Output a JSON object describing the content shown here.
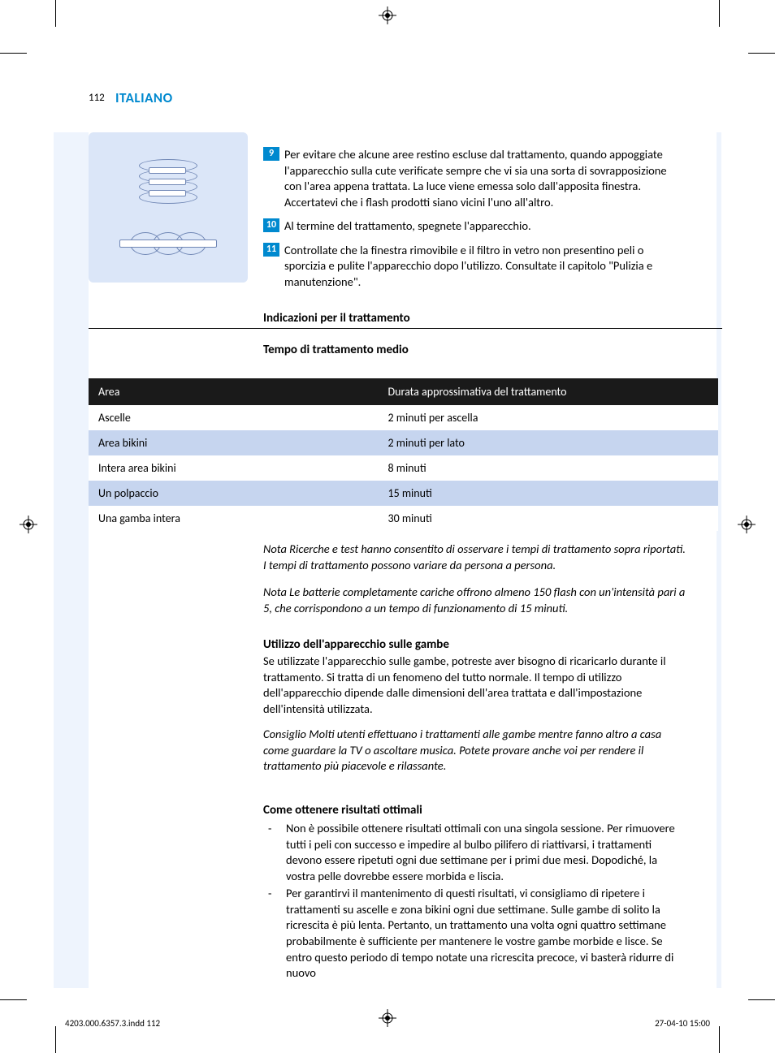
{
  "page_number": "112",
  "language_header": "ITALIANO",
  "instructions": [
    {
      "num": "9",
      "text": "Per evitare che alcune aree restino escluse dal trattamento, quando appoggiate l'apparecchio sulla cute verificate sempre che vi sia una sorta di sovrapposizione con l'area appena trattata. La luce viene emessa solo dall'apposita finestra. Accertatevi che i flash prodotti siano vicini l'uno all'altro."
    },
    {
      "num": "10",
      "text": "Al termine del trattamento, spegnete l'apparecchio."
    },
    {
      "num": "11",
      "text": "Controllate che la finestra rimovibile e il filtro in vetro non presentino peli o sporcizia e pulite l'apparecchio dopo l'utilizzo. Consultate il capitolo \"Pulizia e manutenzione\"."
    }
  ],
  "heading1": "Indicazioni per il trattamento",
  "heading2": "Tempo di trattamento medio",
  "table": {
    "headers": [
      "Area",
      "Durata approssimativa del trattamento"
    ],
    "rows": [
      {
        "area": "Ascelle",
        "duration": "2 minuti per ascella"
      },
      {
        "area": "Area bikini",
        "duration": "2 minuti per lato"
      },
      {
        "area": "Intera area bikini",
        "duration": "8 minuti"
      },
      {
        "area": "Un polpaccio",
        "duration": "15 minuti"
      },
      {
        "area": "Una gamba intera",
        "duration": "30 minuti"
      }
    ]
  },
  "note1": "Nota Ricerche e test hanno consentito di osservare i tempi di trattamento sopra riportati. I tempi di trattamento possono variare da persona a persona.",
  "note2": "Nota Le batterie completamente cariche offrono almeno 150 flash con un'intensità pari a 5, che corrispondono a un tempo di funzionamento di 15 minuti.",
  "section_legs": {
    "title": "Utilizzo dell'apparecchio sulle gambe",
    "body": "Se utilizzate l'apparecchio sulle gambe, potreste aver bisogno di ricaricarlo durante il trattamento. Si tratta di un fenomeno del tutto normale. Il tempo di utilizzo dell'apparecchio dipende dalle dimensioni dell'area trattata e dall'impostazione dell'intensità utilizzata.",
    "tip": "Consiglio Molti utenti effettuano i trattamenti alle gambe mentre fanno altro a casa come guardare la TV o ascoltare musica. Potete provare anche voi per rendere il trattamento più piacevole e rilassante."
  },
  "section_results": {
    "title": "Come ottenere risultati ottimali",
    "bullets": [
      "Non è possibile ottenere risultati ottimali con una singola sessione. Per rimuovere tutti i peli con successo e impedire al bulbo pilifero di riattivarsi, i trattamenti devono essere ripetuti ogni due settimane per i primi due mesi. Dopodiché, la vostra pelle dovrebbe essere morbida e liscia.",
      "Per garantirvi il mantenimento di questi risultati, vi consigliamo di ripetere i trattamenti su ascelle e zona bikini ogni due settimane. Sulle gambe di solito la ricrescita è più lenta. Pertanto, un trattamento una volta ogni quattro settimane probabilmente è sufficiente per mantenere le vostre gambe morbide e lisce. Se entro questo periodo di tempo notate una ricrescita precoce, vi basterà ridurre di nuovo"
    ]
  },
  "footer": {
    "file": "4203.000.6357.3.indd   112",
    "date": "27-04-10   15:00"
  }
}
